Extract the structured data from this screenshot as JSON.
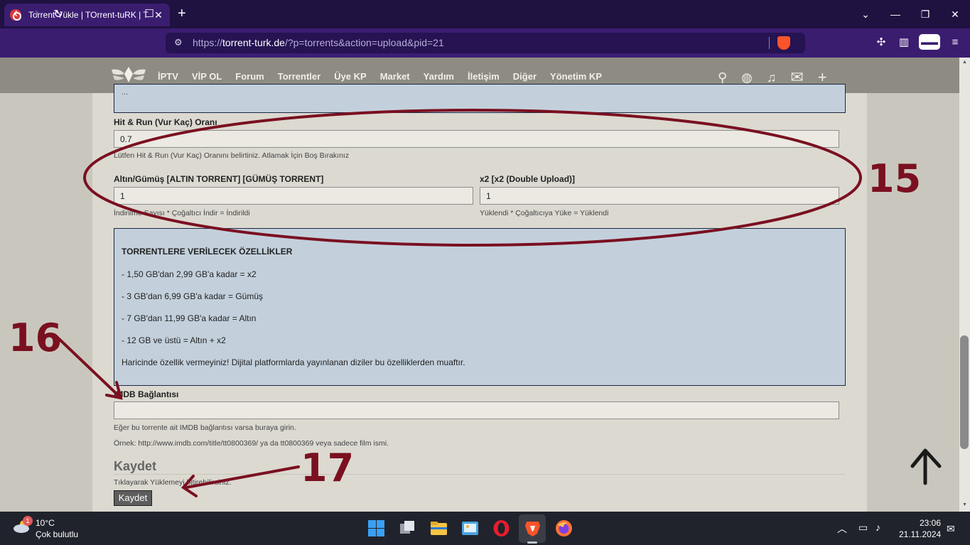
{
  "browser": {
    "tab_title": "Torrent Yükle | TOrrent-tuRK | T...",
    "tab_close": "✕",
    "new_tab": "+",
    "url_prefix": "https://",
    "url_domain": "torrent-turk.de",
    "url_path": "/?p=torrents&action=upload&pid=21"
  },
  "site": {
    "menu": [
      "İPTV",
      "VİP OL",
      "Forum",
      "Torrentler",
      "Üye KP",
      "Market",
      "Yardım",
      "İletişim",
      "Diğer",
      "Yönetim KP"
    ]
  },
  "form": {
    "top_info": "...",
    "hitrun_label": "Hit & Run (Vur Kaç) Oranı",
    "hitrun_value": "0.7",
    "hitrun_hint": "Lütfen Hit & Run (Vur Kaç) Oranını belirtiniz. Atlamak İçin Boş Bırakınız",
    "gold_label": "Altın/Gümüş [ALTIN TORRENT] [GÜMÜŞ TORRENT]",
    "gold_value": "1",
    "gold_hint": "İndirilme Sayısı * Çoğaltıcı İndir = İndirildi",
    "x2_label": "x2 [x2 (Double Upload)]",
    "x2_value": "1",
    "x2_hint": "Yüklendi * Çoğaltıcıya Yüke = Yüklendi",
    "info_title": "TORRENTLERE VERİLECEK ÖZELLİKLER",
    "info_lines": [
      "- 1,50 GB'dan 2,99 GB'a kadar = x2",
      "- 3 GB'dan 6,99 GB'a kadar = Gümüş",
      "- 7 GB'dan 11,99 GB'a kadar = Altın",
      "- 12 GB ve üstü = Altın + x2",
      "Haricinde özellik vermeyiniz! Dijital platformlarda yayınlanan diziler bu özelliklerden muaftır."
    ],
    "imdb_label": "IMDB Bağlantısı",
    "imdb_value": "",
    "imdb_hint1": "Eğer bu torrente ait IMDB bağlantısı varsa buraya girin.",
    "imdb_hint2": "Örnek: http://www.imdb.com/title/tt0800369/ ya da tt0800369 veya sadece film ismi.",
    "save_title": "Kaydet",
    "save_hint": "Tıklayarak Yüklemeyi bitirebilirsiniz.",
    "save_button": "Kaydet"
  },
  "annotations": {
    "a15": "15",
    "a16": "16",
    "a17": "17"
  },
  "taskbar": {
    "weather_badge": "1",
    "weather_temp": "10°C",
    "weather_desc": "Çok bulutlu",
    "time": "23:06",
    "date": "21.11.2024"
  },
  "colors": {
    "annotation": "#7a1020",
    "browser": "#3b1d70",
    "header": "#8e8c82",
    "infobox": "#c3d0dc"
  }
}
